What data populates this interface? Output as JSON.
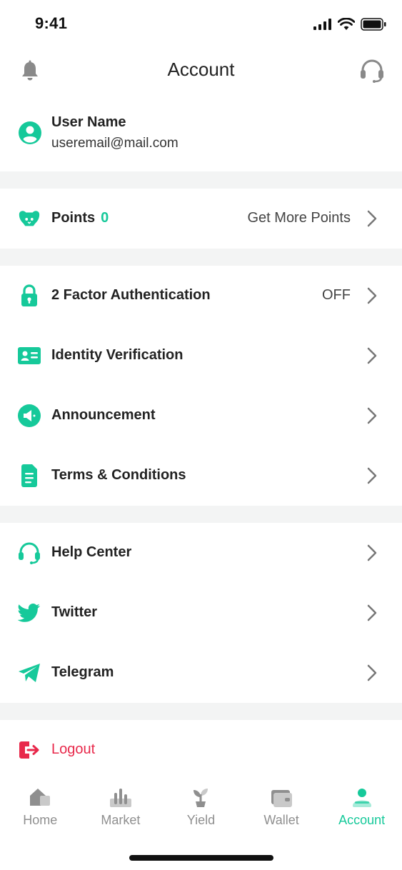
{
  "colors": {
    "accent": "#16c99a",
    "danger": "#e8294b",
    "chevron": "#777777",
    "divider": "#f3f4f4"
  },
  "status_bar": {
    "time": "9:41"
  },
  "header": {
    "title": "Account",
    "left_icon": "bell-icon",
    "right_icon": "headset-icon"
  },
  "user": {
    "name": "User Name",
    "email": "useremail@mail.com"
  },
  "points": {
    "label": "Points",
    "count": "0",
    "action": "Get More Points"
  },
  "security": [
    {
      "label": "2 Factor Authentication",
      "value": "OFF",
      "icon": "lock-icon"
    },
    {
      "label": "Identity Verification",
      "value": "",
      "icon": "id-card-icon"
    },
    {
      "label": "Announcement",
      "value": "",
      "icon": "megaphone-icon"
    },
    {
      "label": "Terms & Conditions",
      "value": "",
      "icon": "document-icon"
    }
  ],
  "community": [
    {
      "label": "Help Center",
      "icon": "headset-icon"
    },
    {
      "label": "Twitter",
      "icon": "twitter-icon"
    },
    {
      "label": "Telegram",
      "icon": "telegram-icon"
    }
  ],
  "logout": {
    "label": "Logout"
  },
  "tabs": [
    {
      "label": "Home",
      "icon": "home-icon",
      "active": false
    },
    {
      "label": "Market",
      "icon": "market-icon",
      "active": false
    },
    {
      "label": "Yield",
      "icon": "yield-icon",
      "active": false
    },
    {
      "label": "Wallet",
      "icon": "wallet-icon",
      "active": false
    },
    {
      "label": "Account",
      "icon": "account-icon",
      "active": true
    }
  ]
}
